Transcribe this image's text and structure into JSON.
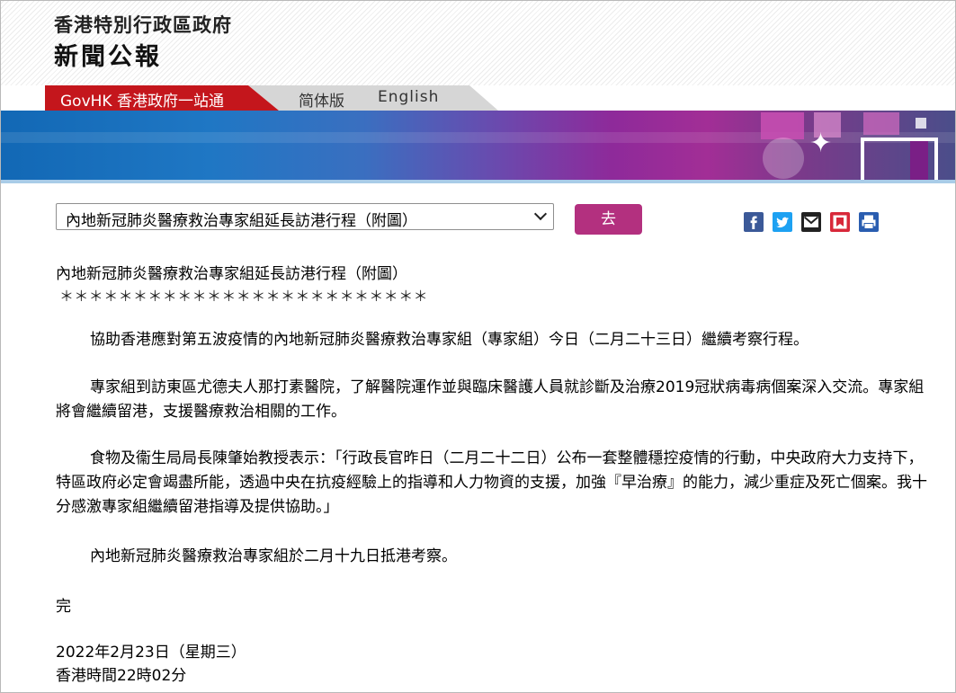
{
  "header": {
    "government_name": "香港特別行政區政府",
    "section_title": "新聞公報"
  },
  "nav": {
    "govhk_label": "GovHK 香港政府一站通",
    "simplified_label": "简体版",
    "english_label": "English"
  },
  "article_select": {
    "selected": "內地新冠肺炎醫療救治專家組延長訪港行程（附圖）"
  },
  "go_button": {
    "label": "去"
  },
  "share_icons": [
    "facebook-icon",
    "twitter-icon",
    "email-icon",
    "bookmark-icon",
    "print-icon"
  ],
  "colors": {
    "govhk_red": "#c4161c",
    "go_button": "#b3307f",
    "facebook": "#3b5998",
    "twitter": "#1da1f2"
  },
  "article": {
    "title": "內地新冠肺炎醫療救治專家組延長訪港行程（附圖）",
    "stars": "＊＊＊＊＊＊＊＊＊＊＊＊＊＊＊＊＊＊＊＊＊＊＊＊＊",
    "paragraphs": [
      "協助香港應對第五波疫情的內地新冠肺炎醫療救治專家組（專家組）今日（二月二十三日）繼續考察行程。",
      "專家組到訪東區尤德夫人那打素醫院，了解醫院運作並與臨床醫護人員就診斷及治療2019冠狀病毒病個案深入交流。專家組將會繼續留港，支援醫療救治相關的工作。",
      "食物及衞生局局長陳肇始教授表示：「行政長官昨日（二月二十二日）公布一套整體穩控疫情的行動，中央政府大力支持下，特區政府必定會竭盡所能，透過中央在抗疫經驗上的指導和人力物資的支援，加強『早治療』的能力，減少重症及死亡個案。我十分感激專家組繼續留港指導及提供協助。」",
      "內地新冠肺炎醫療救治專家組於二月十九日抵港考察。"
    ],
    "end_mark": "完",
    "date": "2022年2月23日（星期三）",
    "time": "香港時間22時02分"
  }
}
